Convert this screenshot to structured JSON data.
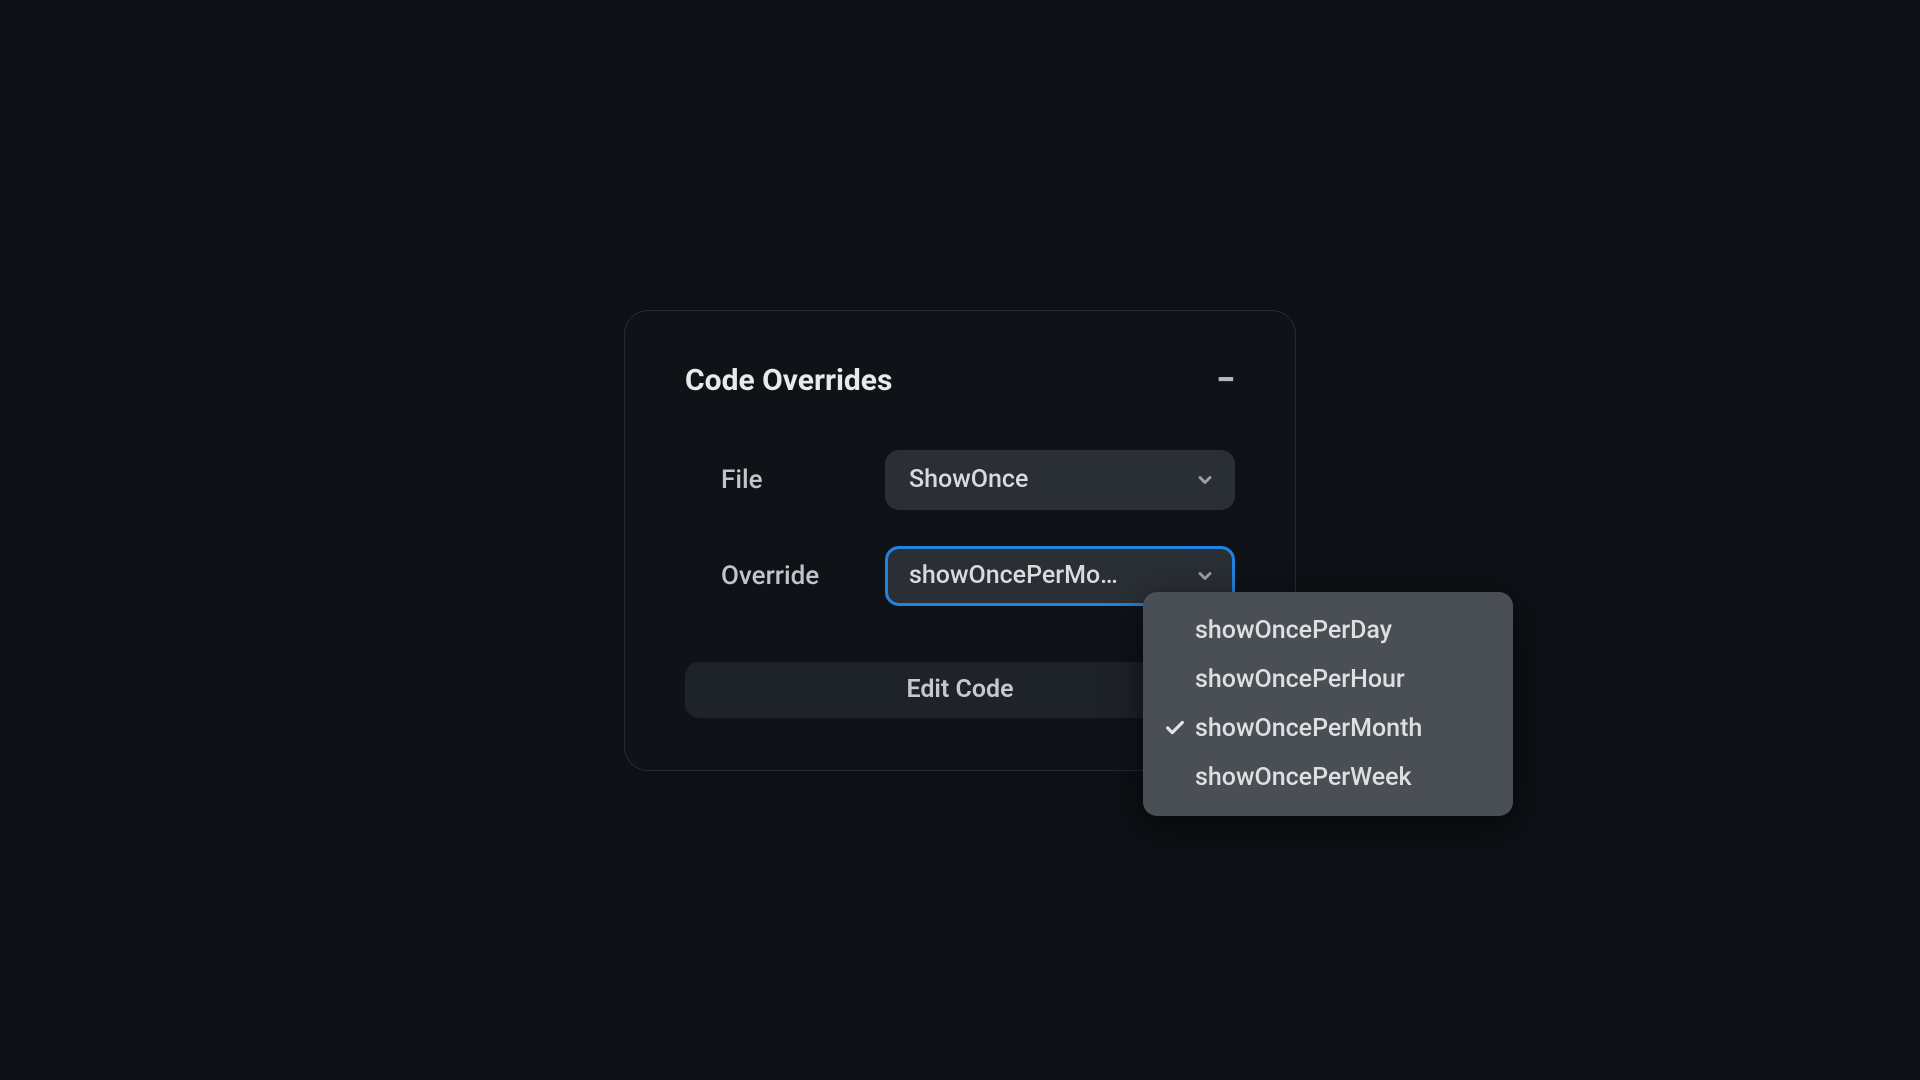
{
  "panel": {
    "title": "Code Overrides",
    "rows": {
      "file": {
        "label": "File",
        "value": "ShowOnce"
      },
      "override": {
        "label": "Override",
        "value": "showOncePerMo…"
      }
    },
    "editButton": "Edit Code"
  },
  "dropdown": {
    "items": [
      {
        "label": "showOncePerDay",
        "checked": false
      },
      {
        "label": "showOncePerHour",
        "checked": false
      },
      {
        "label": "showOncePerMonth",
        "checked": true
      },
      {
        "label": "showOncePerWeek",
        "checked": false
      }
    ]
  },
  "colors": {
    "background": "#0d1015",
    "panel": "#0f1318",
    "field": "#2a2f36",
    "focus": "#2383e2",
    "menu": "#4a4e55"
  }
}
